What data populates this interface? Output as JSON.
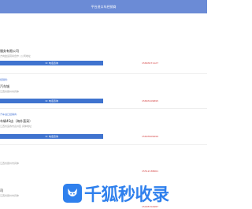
{
  "header": {
    "title": "平台进口车经销商"
  },
  "items": [
    {
      "tag": "",
      "name": "服务有限公司",
      "sub": "方向盘运营商合作 | 公司地址",
      "button_label": "电话咨询",
      "phone": "15803071127"
    },
    {
      "tag": "经销商:",
      "name": "汽车城",
      "sub": "江西省赣州市具体",
      "button_label": "电话咨询",
      "phone": "15803109895"
    },
    {
      "tag": "汽车进口经销商:",
      "name": "车辆4S店（海外直采）",
      "sub": "江西省宜春市袁州区 具体地址",
      "button_label": "电话咨询",
      "phone": "15603909999"
    },
    {
      "tag": "",
      "name": "",
      "sub": "江西省赣州市具体",
      "button_label": "",
      "phone": "15512138661"
    },
    {
      "tag": "",
      "name": "司",
      "sub": "江西省赣州市具体",
      "button_label": "",
      "phone": "15005702987"
    }
  ],
  "watermark": {
    "text": "千狐秒收录",
    "icon": "fox-logo-icon",
    "color": "#2f80ed"
  }
}
